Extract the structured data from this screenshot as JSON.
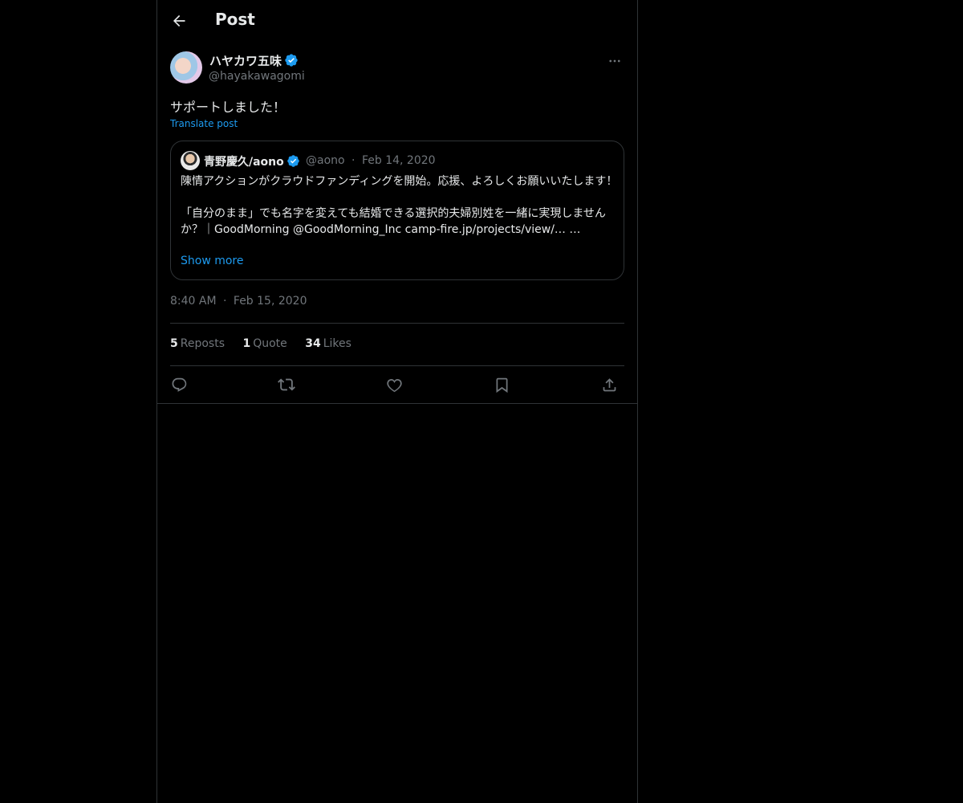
{
  "header": {
    "title": "Post"
  },
  "post": {
    "author_name": "ハヤカワ五味",
    "author_handle": "@hayakawagomi",
    "text": "サポートしました！",
    "translate_label": "Translate post",
    "time": "8:40 AM",
    "separator": "·",
    "date": "Feb 15, 2020"
  },
  "quote": {
    "author_name": "青野慶久/aono",
    "author_handle": "@aono",
    "separator": "·",
    "date": "Feb 14, 2020",
    "text": "陳情アクションがクラウドファンディングを開始。応援、よろしくお願いいたします！\n\n「自分のまま」でも名字を変えても結婚できる選択的夫婦別姓を一緒に実現しませんか？｜GoodMorning @GoodMorning_Inc camp-fire.jp/projects/view/… …",
    "show_more_label": "Show more"
  },
  "stats": {
    "reposts_count": "5",
    "reposts_label": "Reposts",
    "quotes_count": "1",
    "quotes_label": "Quote",
    "likes_count": "34",
    "likes_label": "Likes"
  },
  "icons": {
    "back": "arrow-left-icon",
    "verified": "verified-badge-icon",
    "more": "more-horizontal-icon",
    "reply": "reply-icon",
    "repost": "repost-icon",
    "like": "heart-icon",
    "bookmark": "bookmark-icon",
    "share": "share-icon"
  },
  "colors": {
    "background": "#000000",
    "text_primary": "#e7e9ea",
    "text_secondary": "#71767b",
    "accent": "#1d9bf0",
    "border": "#2f3336"
  }
}
